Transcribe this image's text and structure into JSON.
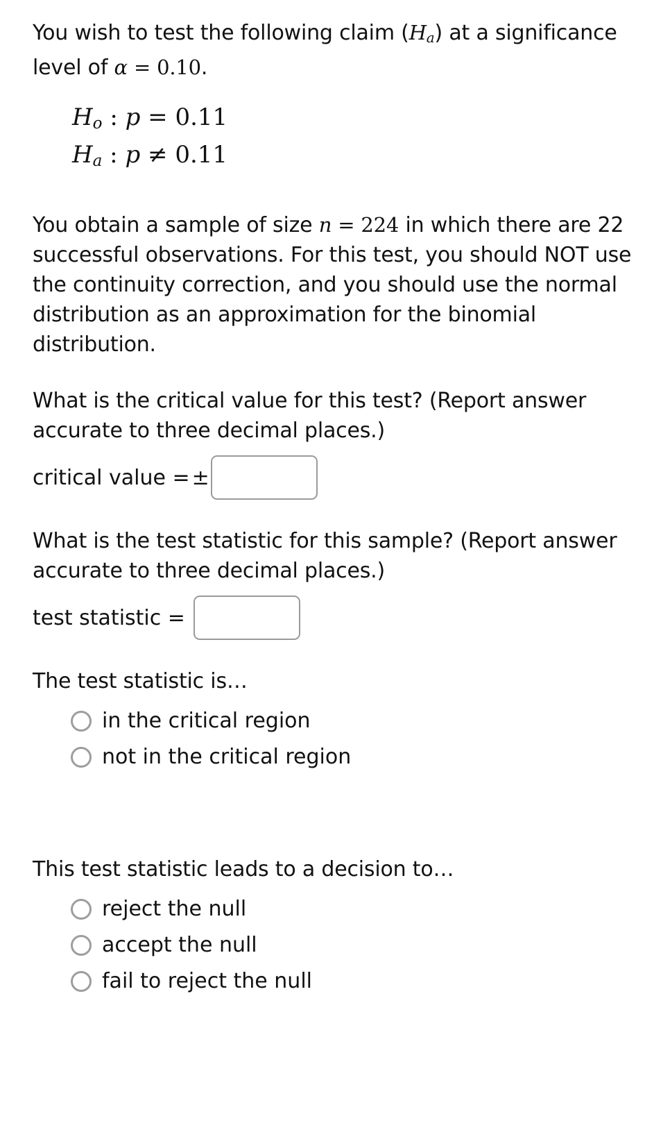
{
  "intro": {
    "text_before": "You wish to test the following claim (",
    "ha_symbol": "H",
    "ha_sub": "a",
    "text_mid": ") at a significance level of ",
    "alpha_symbol": "α",
    "equals": " = ",
    "alpha_value": "0.10",
    "period": "."
  },
  "hypotheses": {
    "null": {
      "symbol": "H",
      "sub": "o",
      "colon": " : ",
      "param": "p",
      "operator": "=",
      "value": "0.11"
    },
    "alternative": {
      "symbol": "H",
      "sub": "a",
      "colon": " : ",
      "param": "p",
      "operator": "≠",
      "value": "0.11"
    }
  },
  "sample": {
    "before_n": "You obtain a sample of size ",
    "n_symbol": "n",
    "n_equals": " = ",
    "n_value": "224",
    "after_n": " in which there are 22 successful observations. For this test, you should NOT use the continuity correction, and you should use the normal distribution as an approximation for the binomial distribution."
  },
  "critical_value_question": {
    "prompt": "What is the critical value for this test? (Report answer accurate to three decimal places.)",
    "label": "critical value =",
    "plus_minus": "±",
    "input_value": "",
    "input_placeholder": ""
  },
  "test_statistic_question": {
    "prompt": "What is the test statistic for this sample? (Report answer accurate to three decimal places.)",
    "label": "test statistic =",
    "input_value": "",
    "input_placeholder": ""
  },
  "region_question": {
    "prompt": "The test statistic is…",
    "options": [
      {
        "label": "in the critical region",
        "selected": false
      },
      {
        "label": "not in the critical region",
        "selected": false
      }
    ]
  },
  "decision_question": {
    "prompt": "This test statistic leads to a decision to…",
    "options": [
      {
        "label": "reject the null",
        "selected": false
      },
      {
        "label": "accept the null",
        "selected": false
      },
      {
        "label": "fail to reject the null",
        "selected": false
      }
    ]
  },
  "colors": {
    "text": "#111111",
    "border": "#9a9a9a",
    "background": "#ffffff"
  }
}
